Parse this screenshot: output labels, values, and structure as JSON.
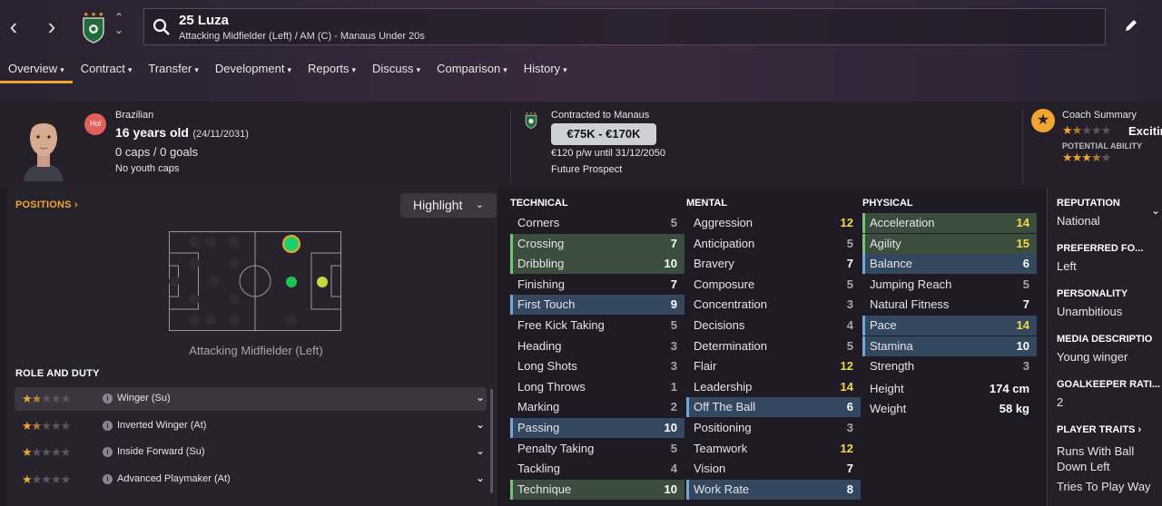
{
  "player": {
    "name": "25 Luza",
    "subtitle": "Attacking Midfielder (Left) / AM (C) - Manaus Under 20s",
    "nationality": "Brazilian",
    "nation_code": "Hol",
    "age": "16 years old",
    "dob": "(24/11/2031)",
    "caps": "0 caps / 0 goals",
    "youth_caps": "No youth caps"
  },
  "tabs": [
    {
      "label": "Overview"
    },
    {
      "label": "Contract"
    },
    {
      "label": "Transfer"
    },
    {
      "label": "Development"
    },
    {
      "label": "Reports"
    },
    {
      "label": "Discuss"
    },
    {
      "label": "Comparison"
    },
    {
      "label": "History"
    }
  ],
  "contract": {
    "club": "Contracted to Manaus",
    "value": "€75K - €170K",
    "wage": "€120 p/w until 31/12/2050",
    "status": "Future Prospect"
  },
  "coach": {
    "title": "Coach Summary",
    "verdict": "Exciting",
    "potential_label": "POTENTIAL ABILITY",
    "current_stars": 1.5,
    "potential_stars": 3.5
  },
  "positions": {
    "title": "POSITIONS",
    "highlight_label": "Highlight",
    "position_label": "Attacking Midfielder (Left)"
  },
  "roles": {
    "title": "ROLE AND DUTY",
    "items": [
      {
        "label": "Winger (Su)",
        "stars": 1.5
      },
      {
        "label": "Inverted Winger (At)",
        "stars": 1.5
      },
      {
        "label": "Inside Forward (Su)",
        "stars": 1
      },
      {
        "label": "Advanced Playmaker (At)",
        "stars": 1
      }
    ]
  },
  "technical": {
    "title": "TECHNICAL",
    "rows": [
      {
        "name": "Corners",
        "value": "5",
        "hl": ""
      },
      {
        "name": "Crossing",
        "value": "7",
        "hl": "g"
      },
      {
        "name": "Dribbling",
        "value": "10",
        "hl": "g"
      },
      {
        "name": "Finishing",
        "value": "7",
        "hl": ""
      },
      {
        "name": "First Touch",
        "value": "9",
        "hl": "b"
      },
      {
        "name": "Free Kick Taking",
        "value": "5",
        "hl": ""
      },
      {
        "name": "Heading",
        "value": "3",
        "hl": ""
      },
      {
        "name": "Long Shots",
        "value": "3",
        "hl": ""
      },
      {
        "name": "Long Throws",
        "value": "1",
        "hl": ""
      },
      {
        "name": "Marking",
        "value": "2",
        "hl": ""
      },
      {
        "name": "Passing",
        "value": "10",
        "hl": "b"
      },
      {
        "name": "Penalty Taking",
        "value": "5",
        "hl": ""
      },
      {
        "name": "Tackling",
        "value": "4",
        "hl": ""
      },
      {
        "name": "Technique",
        "value": "10",
        "hl": "g"
      }
    ]
  },
  "mental": {
    "title": "MENTAL",
    "rows": [
      {
        "name": "Aggression",
        "value": "12",
        "hl": ""
      },
      {
        "name": "Anticipation",
        "value": "5",
        "hl": ""
      },
      {
        "name": "Bravery",
        "value": "7",
        "hl": ""
      },
      {
        "name": "Composure",
        "value": "5",
        "hl": ""
      },
      {
        "name": "Concentration",
        "value": "3",
        "hl": ""
      },
      {
        "name": "Decisions",
        "value": "4",
        "hl": ""
      },
      {
        "name": "Determination",
        "value": "5",
        "hl": ""
      },
      {
        "name": "Flair",
        "value": "12",
        "hl": ""
      },
      {
        "name": "Leadership",
        "value": "14",
        "hl": ""
      },
      {
        "name": "Off The Ball",
        "value": "6",
        "hl": "b"
      },
      {
        "name": "Positioning",
        "value": "3",
        "hl": ""
      },
      {
        "name": "Teamwork",
        "value": "12",
        "hl": ""
      },
      {
        "name": "Vision",
        "value": "7",
        "hl": ""
      },
      {
        "name": "Work Rate",
        "value": "8",
        "hl": "b"
      }
    ]
  },
  "physical": {
    "title": "PHYSICAL",
    "rows": [
      {
        "name": "Acceleration",
        "value": "14",
        "hl": "g"
      },
      {
        "name": "Agility",
        "value": "15",
        "hl": "g"
      },
      {
        "name": "Balance",
        "value": "6",
        "hl": "b"
      },
      {
        "name": "Jumping Reach",
        "value": "5",
        "hl": ""
      },
      {
        "name": "Natural Fitness",
        "value": "7",
        "hl": ""
      },
      {
        "name": "Pace",
        "value": "14",
        "hl": "b"
      },
      {
        "name": "Stamina",
        "value": "10",
        "hl": "b"
      },
      {
        "name": "Strength",
        "value": "3",
        "hl": ""
      }
    ],
    "height_label": "Height",
    "height": "174 cm",
    "weight_label": "Weight",
    "weight": "58 kg"
  },
  "side": {
    "reputation_title": "REPUTATION",
    "reputation": "National",
    "foot_title": "PREFERRED FO...",
    "foot": "Left",
    "personality_title": "PERSONALITY",
    "personality": "Unambitious",
    "media_title": "MEDIA DESCRIPTIO",
    "media": "Young winger",
    "gk_title": "GOALKEEPER RATI...",
    "gk": "2",
    "traits_title": "PLAYER TRAITS",
    "trait1": "Runs With Ball",
    "trait1b": "Down Left",
    "trait2": "Tries To Play Way"
  },
  "colors": {
    "accent": "#f0a530",
    "green_row": "#3b4e3e",
    "blue_row": "#33485e",
    "yellow_value": "#f5d84a"
  }
}
